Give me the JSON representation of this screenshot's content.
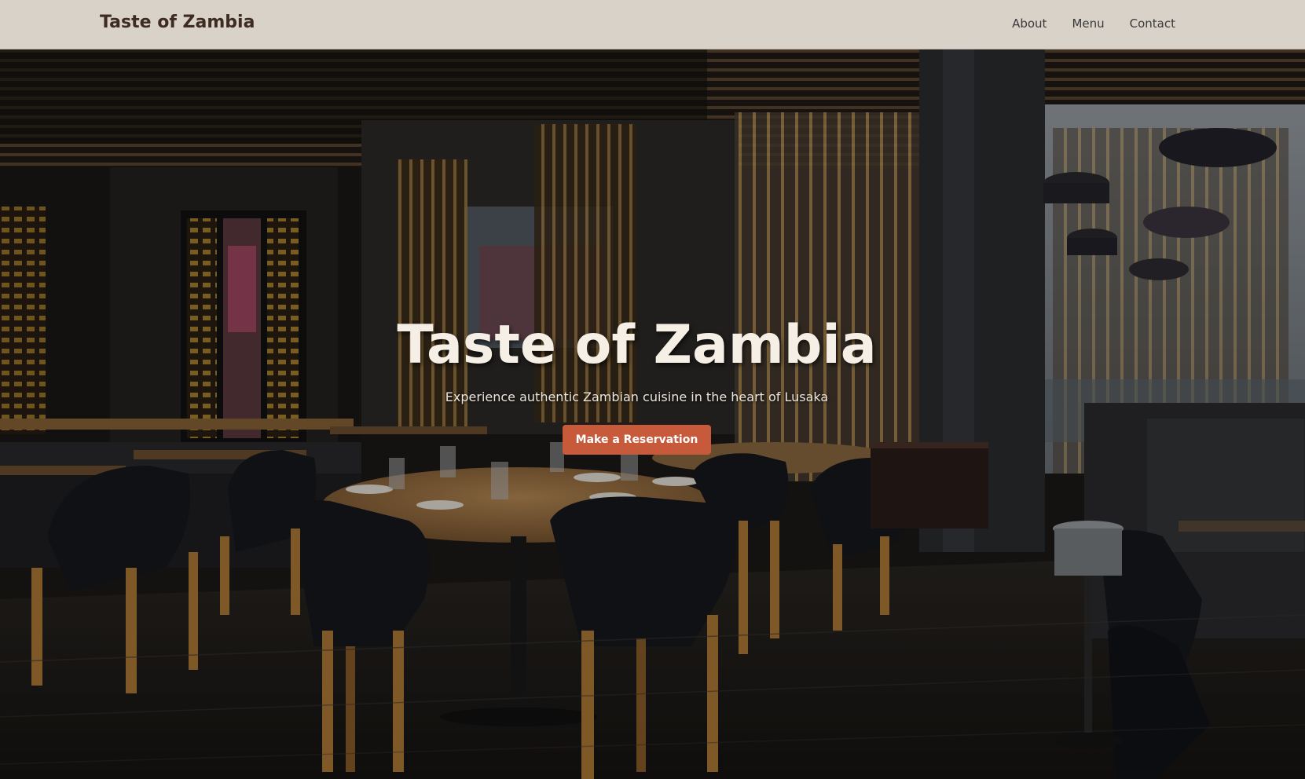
{
  "navbar": {
    "brand": "Taste of Zambia",
    "links": [
      {
        "label": "About"
      },
      {
        "label": "Menu"
      },
      {
        "label": "Contact"
      }
    ]
  },
  "hero": {
    "title": "Taste of Zambia",
    "subtitle": "Experience authentic Zambian cuisine in the heart of Lusaka",
    "cta_label": "Make a Reservation"
  },
  "colors": {
    "navbar_bg": "#d9d2c8",
    "brand_text": "#3e2b22",
    "cta_bg": "#c85a3c",
    "hero_text": "#f5efe6"
  }
}
